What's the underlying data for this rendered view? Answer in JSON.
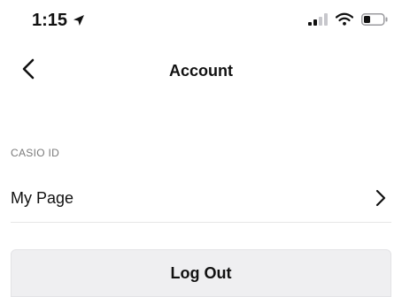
{
  "status_bar": {
    "time": "1:15",
    "icons": [
      "location-arrow-icon",
      "cellular-signal-icon",
      "wifi-icon",
      "battery-icon"
    ]
  },
  "nav": {
    "back_icon": "chevron-left-icon",
    "title": "Account"
  },
  "section": {
    "header": "CASIO ID",
    "items": [
      {
        "label": "My Page",
        "icon": "chevron-right-icon"
      }
    ]
  },
  "logout": {
    "label": "Log Out"
  },
  "colors": {
    "background": "#ffffff",
    "text": "#111111",
    "section_header": "#7a7a7a",
    "button_background": "#efeff1",
    "divider": "#e6e6e6"
  }
}
